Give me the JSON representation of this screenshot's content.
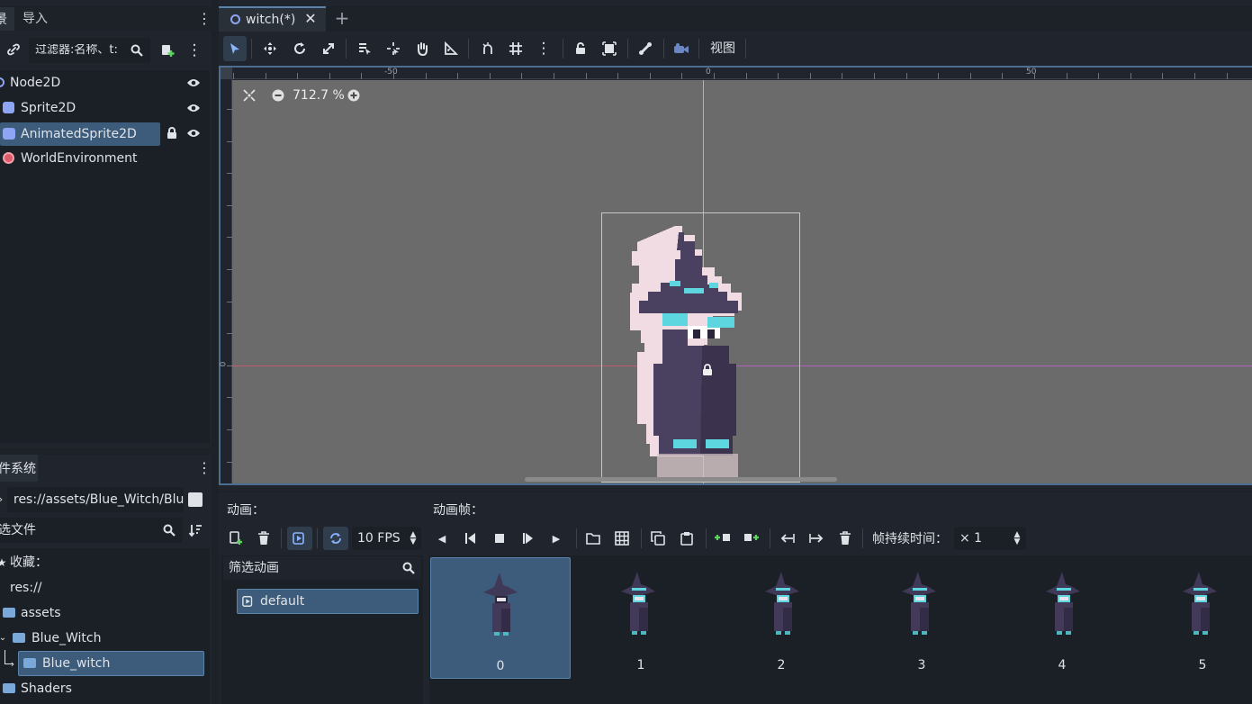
{
  "scene_dock": {
    "tab_scene": "景",
    "tab_import": "导入",
    "filter_placeholder": "过滤器:名称、t:",
    "nodes": [
      {
        "label": "Node2D"
      },
      {
        "label": "Sprite2D"
      },
      {
        "label": "AnimatedSprite2D"
      },
      {
        "label": "WorldEnvironment"
      }
    ]
  },
  "filesystem_dock": {
    "title": "件系统",
    "path": "res://assets/Blue_Witch/Blu",
    "filter_placeholder": "选文件",
    "favorites": "收藏：",
    "tree": [
      {
        "label": "res://"
      },
      {
        "label": "assets"
      },
      {
        "label": "Blue_Witch"
      },
      {
        "label": "Blue_witch"
      },
      {
        "label": "Shaders"
      }
    ]
  },
  "editor": {
    "tab_label": "witch(*)",
    "view_menu": "视图",
    "zoom": "712.7 %",
    "ruler_labels": [
      "-50",
      "0",
      "50"
    ],
    "ruler_left_label": "0"
  },
  "sprite_frames": {
    "animations_label": "动画：",
    "frames_label": "动画帧：",
    "fps": "10 FPS",
    "duration_label": "帧持续时间：",
    "duration_value": "× 1",
    "filter_placeholder": "筛选动画",
    "animations": [
      "default"
    ],
    "frames": [
      "0",
      "1",
      "2",
      "3",
      "4",
      "5"
    ]
  },
  "colors": {
    "accent": "#4b6e91",
    "selection": "#3d5b7a",
    "panel": "#20252d",
    "viewport": "#6b6b6b"
  }
}
